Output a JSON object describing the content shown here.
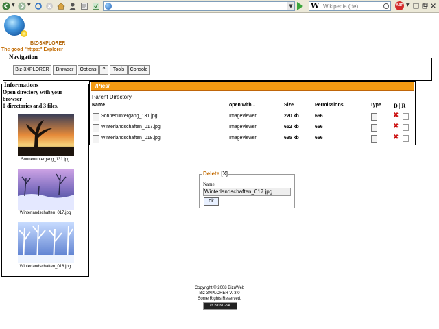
{
  "browser": {
    "address_value": "",
    "search_engine_icon": "W",
    "search_placeholder": "Wikipedia (de)",
    "adblock_label": "ABP"
  },
  "app": {
    "title": "BIZ-3XPLORER",
    "tagline": "The good \"https:\" Explorer"
  },
  "navigation": {
    "legend": "Navigation",
    "buttons": [
      "Biz-3XPLORER",
      "Browser",
      "Options",
      "?",
      "Tools",
      "Console"
    ]
  },
  "informations": {
    "legend": "Informations",
    "line1": "Open directory with your",
    "line2": "browser",
    "line3": "0 directories and 3 files.",
    "thumbnails": [
      {
        "caption": "Sonnenuntergang_131.jpg"
      },
      {
        "caption": "Winterlandschaften_017.jpg"
      },
      {
        "caption": "Winterlandschaften_018.jpg"
      }
    ]
  },
  "pics": {
    "title": "/Pics/",
    "parent_directory": "Parent Directory",
    "headers": {
      "name": "Name",
      "open_with": "open with...",
      "size": "Size",
      "permissions": "Permissions",
      "type": "Type",
      "dr": "D | R"
    },
    "files": [
      {
        "name": "Sonnenuntergang_131.jpg",
        "open_with": "Imageviewer",
        "size": "220 kb",
        "permissions": "666"
      },
      {
        "name": "Winterlandschaften_017.jpg",
        "open_with": "Imageviewer",
        "size": "652 kb",
        "permissions": "666"
      },
      {
        "name": "Winterlandschaften_018.jpg",
        "open_with": "Imageviewer",
        "size": "695 kb",
        "permissions": "666"
      }
    ]
  },
  "delete_dialog": {
    "legend": "Delete",
    "close": "[X]",
    "name_label": "Name",
    "name_value": "Winterlandschaften_017.jpg",
    "ok_label": "ok"
  },
  "footer": {
    "line1": "Copyright © 2008 BizuWeb",
    "line2": "Biz-3XPLORER V. 3.0",
    "line3": "Some Rights Reserved.",
    "badge": "cc BY-NC-SA"
  },
  "colors": {
    "accent": "#f39a12",
    "brand_orange": "#c26a00",
    "delete_red": "#cc1111"
  }
}
